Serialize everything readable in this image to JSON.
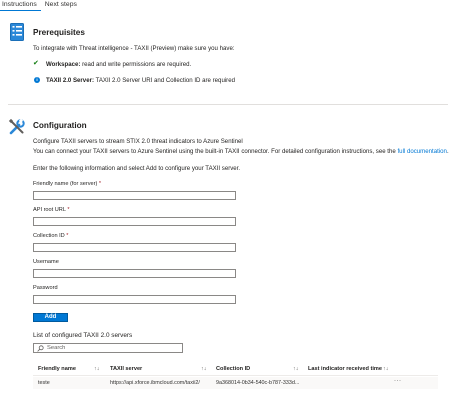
{
  "tabs": [
    {
      "label": "Instructions",
      "active": true
    },
    {
      "label": "Next steps",
      "active": false
    }
  ],
  "prerequisites": {
    "title": "Prerequisites",
    "intro": "To integrate with Threat intelligence - TAXII (Preview) make sure you have:",
    "items": [
      {
        "icon": "checkmark-icon",
        "bold": "Workspace:",
        "text": " read and write permissions are required."
      },
      {
        "icon": "info-icon",
        "bold": "TAXII 2.0 Server:",
        "text": " TAXII 2.0 Server URI and Collection ID are required"
      }
    ]
  },
  "configuration": {
    "title": "Configuration",
    "heading": "Configure TAXII servers to stream STIX 2.0 threat indicators to Azure Sentinel",
    "description": "You can connect your TAXII servers to Azure Sentinel using the built-in TAXII connector. For detailed configuration instructions, see the ",
    "doc_link": "full documentation",
    "doc_link_suffix": ".",
    "form_intro": "Enter the following information and select Add to configure your TAXII server.",
    "fields": [
      {
        "label": "Friendly name (for server)",
        "required": "*",
        "value": ""
      },
      {
        "label": "API root URL",
        "required": "*",
        "value": ""
      },
      {
        "label": "Collection ID",
        "required": "*",
        "value": ""
      },
      {
        "label": "Username",
        "required": "",
        "value": ""
      },
      {
        "label": "Password",
        "required": "",
        "value": ""
      }
    ],
    "add_button": "Add"
  },
  "servers": {
    "title": "List of configured TAXII 2.0 servers",
    "search_placeholder": "Search",
    "columns": [
      "Friendly name",
      "TAXII server",
      "Collection ID",
      "Last indicator received time"
    ],
    "sort_glyph": "↑↓",
    "rows": [
      {
        "name": "teste",
        "server": "https://api.xforce.ibmcloud.com/taxii2/",
        "collection": "9a368014-0b34-540c-b787-333d...",
        "last": "",
        "more": "···"
      }
    ]
  },
  "colors": {
    "accent": "#0078d4",
    "success": "#107c10",
    "required": "#a4262c"
  }
}
